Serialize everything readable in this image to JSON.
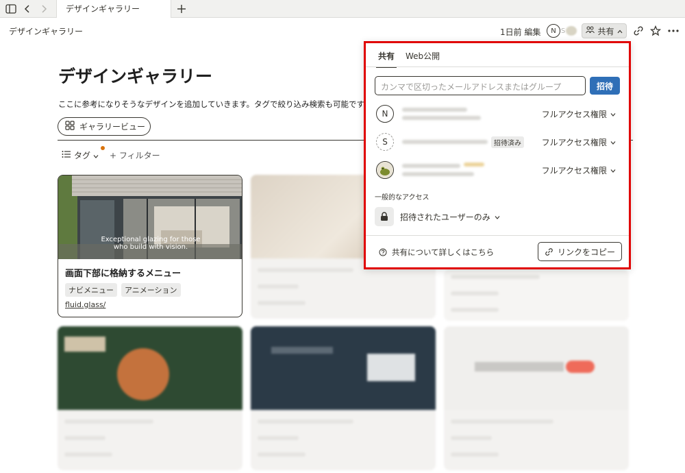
{
  "tab": {
    "title": "デザインギャラリー"
  },
  "header": {
    "crumb": "デザインギャラリー",
    "edited": "1日前 編集",
    "avatars": [
      "N",
      "S"
    ],
    "share_label": "共有"
  },
  "page": {
    "title": "デザインギャラリー",
    "description": "ここに参考になりそうなデザインを追加していきます。タグで絞り込み検索も可能です",
    "view_label": "ギャラリービュー",
    "tag_label": "タグ",
    "filter_label": "+ フィルター"
  },
  "card": {
    "overlay_line1": "Exceptional glazing for those",
    "overlay_line2": "who build with vision.",
    "title": "画面下部に格納するメニュー",
    "tags": [
      "ナビメニュー",
      "アニメーション"
    ],
    "link": "fluid.glass/"
  },
  "popover": {
    "tabs": [
      "共有",
      "Web公開"
    ],
    "input_placeholder": "カンマで区切ったメールアドレスまたはグループ",
    "invite_label": "招待",
    "members": [
      {
        "avatar": "N",
        "permission": "フルアクセス権限"
      },
      {
        "avatar": "S",
        "badge": "招待済み",
        "permission": "フルアクセス権限"
      },
      {
        "avatar": "",
        "permission": "フルアクセス権限"
      }
    ],
    "general_access": "一般的なアクセス",
    "access_value": "招待されたユーザーのみ",
    "learn_more": "共有について詳しくはこちら",
    "copy_link": "リンクをコピー"
  },
  "colors": {
    "accent": "#2f6fb7",
    "highlight": "#e00000"
  }
}
